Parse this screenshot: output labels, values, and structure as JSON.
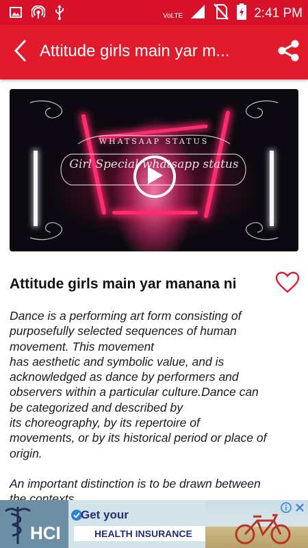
{
  "status_bar": {
    "time": "2:41 PM",
    "network": "VoLTE",
    "network_badge": "LTE",
    "icons": [
      "image-icon",
      "hotspot-icon",
      "usb-icon",
      "signal-icon",
      "no-sim-icon",
      "battery-charging-icon"
    ]
  },
  "app_bar": {
    "title": "Attitude girls main yar m...",
    "back_icon": "back-arrow-icon",
    "share_icon": "share-icon",
    "color": "#e11b2b"
  },
  "video": {
    "overlay_top": "WHATSAAP STATUS",
    "overlay_script": "Girl Special whatsapp status",
    "play_icon": "play-icon"
  },
  "post": {
    "title": "Attitude girls main yar manana ni",
    "favorite_icon": "heart-outline-icon",
    "paragraph_1": "Dance is a performing art form consisting of\npurposefully selected sequences of human\nmovement. This movement\nhas aesthetic and symbolic value, and is\nacknowledged as dance by performers and\nobservers within a particular culture.Dance can\nbe categorized and described by\nits choreography, by its repertoire of\nmovements, or by its historical period or place of\norigin.",
    "paragraph_2": "An important distinction is to be drawn between\nthe contexts"
  },
  "ad": {
    "brand": "HCI",
    "headline_1": "Get your",
    "headline_2": "HEALTH INSURANCE",
    "info_icon": "ad-info-icon",
    "close_icon": "ad-close-icon"
  }
}
